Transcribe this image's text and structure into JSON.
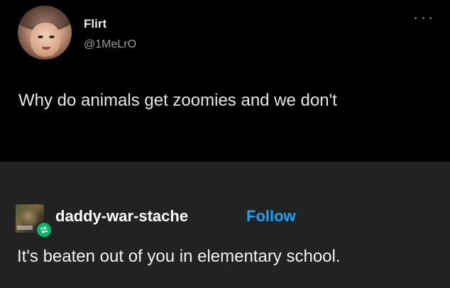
{
  "tweet": {
    "display_name": "Flirt",
    "handle": "@1MeLrO",
    "text": "Why do animals get zoomies and we don't"
  },
  "post": {
    "username": "daddy-war-stache",
    "follow_label": "Follow",
    "body": "It's beaten out of you in elementary school."
  },
  "colors": {
    "tweet_background": "#000000",
    "post_background": "#222222",
    "follow_link": "#1da1f2",
    "reblog_badge": "#00b86b"
  },
  "icons": {
    "more": "more-options-icon",
    "reblog": "reblog-icon"
  }
}
